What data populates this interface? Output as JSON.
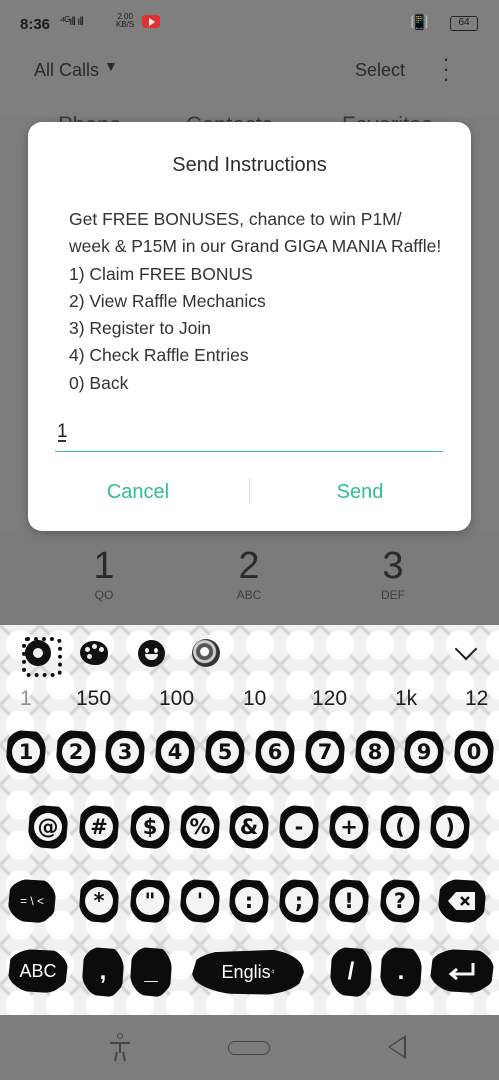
{
  "status_bar": {
    "time": "8:36",
    "signal": "⁴ᴳıll ıll",
    "speed_value": "2.00",
    "speed_unit": "KB/S",
    "battery": "64",
    "vibrate_icon": "📳"
  },
  "dialer": {
    "filter_label": "All Calls",
    "select_label": "Select",
    "tabs_partial": [
      "Phone",
      "Contacts",
      "Favorites"
    ],
    "keys": [
      {
        "num": "1",
        "sub": "QO"
      },
      {
        "num": "2",
        "sub": "ABC"
      },
      {
        "num": "3",
        "sub": "DEF"
      }
    ]
  },
  "dialog": {
    "title": "Send Instructions",
    "message_lines": [
      "Get FREE BONUSES, chance to win P1M/",
      "week & P15M in our Grand GIGA MANIA Raffle!",
      "1) Claim FREE BONUS",
      "2) View Raffle Mechanics",
      "3) Register to Join",
      "4) Check Raffle Entries",
      "0) Back"
    ],
    "input_value": "1",
    "cancel_label": "Cancel",
    "send_label": "Send",
    "accent_color": "#2fbf8a"
  },
  "keyboard": {
    "toolbar_icons": [
      "settings-gear-icon",
      "theme-palette-icon",
      "emoji-icon",
      "sticker-icon",
      "hide-keyboard-chevron-icon"
    ],
    "suggestions": [
      "1",
      "150",
      "100",
      "10",
      "120",
      "1k",
      "12"
    ],
    "row_numbers": [
      "1",
      "2",
      "3",
      "4",
      "5",
      "6",
      "7",
      "8",
      "9",
      "0"
    ],
    "row_symbols1": [
      "@",
      "#",
      "$",
      "%",
      "&",
      "-",
      "+",
      "(",
      ")"
    ],
    "row_symbols2_switch": "= \\ <",
    "row_symbols2": [
      "*",
      "\"",
      "'",
      ":",
      ";",
      "!",
      "?"
    ],
    "abc_label": "ABC",
    "comma": ",",
    "underscore": "_",
    "space_label": "Englis",
    "space_hint": "⁴",
    "slash": "/",
    "backspace_icon": "backspace-icon",
    "enter_icon": "enter-icon"
  }
}
